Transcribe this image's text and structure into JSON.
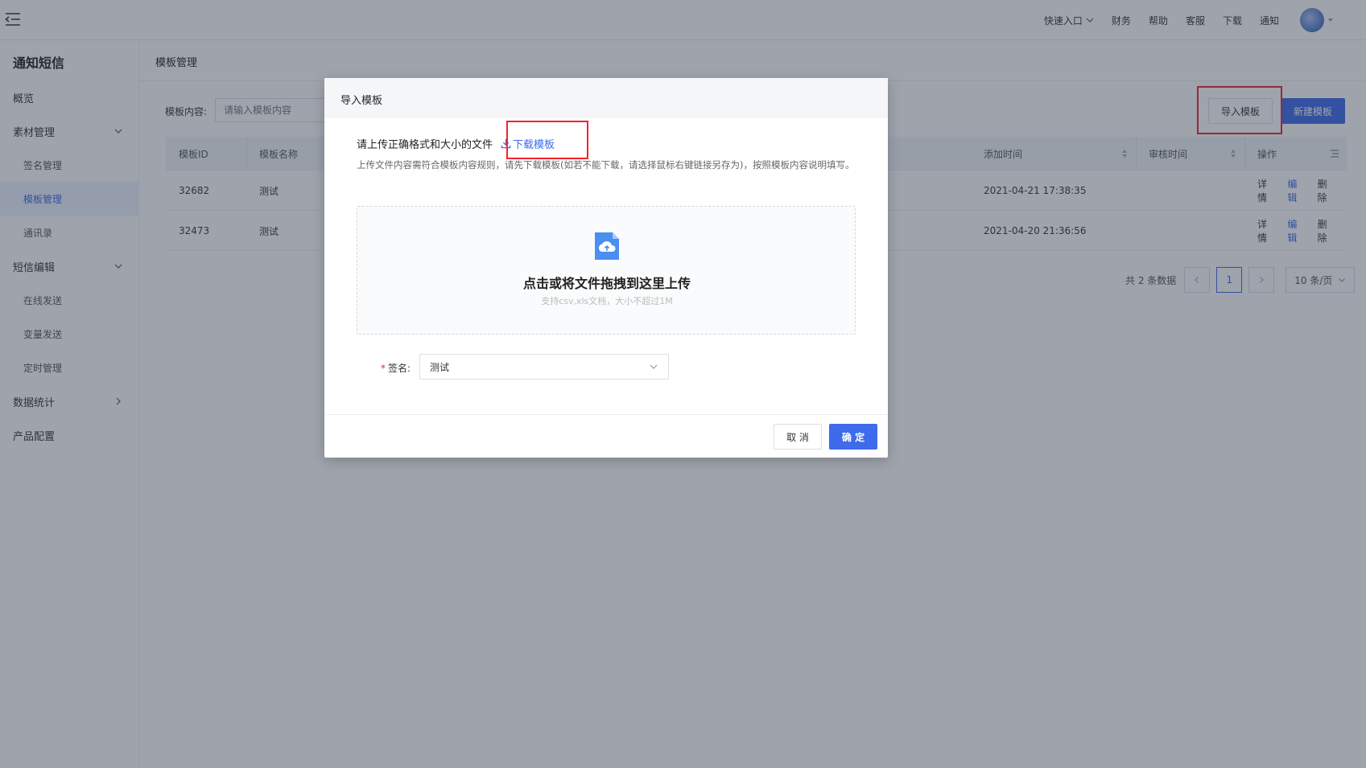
{
  "header": {
    "quick_entry": "快速入口",
    "nav": [
      "财务",
      "帮助",
      "客服",
      "下载",
      "通知"
    ]
  },
  "sidebar": {
    "title": "通知短信",
    "items": [
      {
        "label": "概览",
        "level": 1
      },
      {
        "label": "素材管理",
        "level": 1,
        "expandable": true,
        "expanded": true
      },
      {
        "label": "签名管理",
        "level": 2
      },
      {
        "label": "模板管理",
        "level": 2,
        "active": true
      },
      {
        "label": "通讯录",
        "level": 2
      },
      {
        "label": "短信编辑",
        "level": 1,
        "expandable": true,
        "expanded": true
      },
      {
        "label": "在线发送",
        "level": 2
      },
      {
        "label": "变量发送",
        "level": 2
      },
      {
        "label": "定时管理",
        "level": 2
      },
      {
        "label": "数据统计",
        "level": 1,
        "expandable": true,
        "expanded": false
      },
      {
        "label": "产品配置",
        "level": 1
      }
    ]
  },
  "page": {
    "title": "模板管理",
    "filter_label": "模板内容:",
    "filter_placeholder": "请输入模板内容",
    "import_button": "导入模板",
    "new_button": "新建模板"
  },
  "table": {
    "columns": [
      "模板ID",
      "模板名称",
      "添加时间",
      "审核时间",
      "操作"
    ],
    "rows": [
      {
        "id": "32682",
        "name": "测试",
        "added": "2021-04-21 17:38:35",
        "reviewed": ""
      },
      {
        "id": "32473",
        "name": "测试",
        "added": "2021-04-20 21:36:56",
        "reviewed": ""
      }
    ],
    "actions": [
      "详情",
      "编辑",
      "删除"
    ]
  },
  "pagination": {
    "total": "共 2 条数据",
    "current": "1",
    "page_size": "10 条/页"
  },
  "modal": {
    "title": "导入模板",
    "heading": "请上传正确格式和大小的文件",
    "download_link": "下载模板",
    "description": "上传文件内容需符合模板内容规则，请先下载模板(如若不能下载，请选择鼠标右键链接另存为)，按照模板内容说明填写。",
    "dropzone_title": "点击或将文件拖拽到这里上传",
    "dropzone_hint": "支持csv,xls文档，大小不超过1M",
    "signature_label": "签名:",
    "signature_value": "测试",
    "cancel": "取 消",
    "ok": "确 定"
  },
  "colors": {
    "primary": "#3d6bea",
    "highlight": "#f5222d",
    "overlay": "rgba(40,50,70,0.45)"
  }
}
